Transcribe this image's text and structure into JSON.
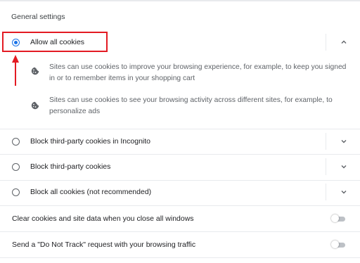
{
  "section": {
    "title": "General settings"
  },
  "options": [
    {
      "label": "Allow all cookies",
      "selected": true,
      "expanded": true,
      "icon": "chevron-up-icon"
    },
    {
      "label": "Block third-party cookies in Incognito",
      "selected": false,
      "expanded": false,
      "icon": "chevron-down-icon"
    },
    {
      "label": "Block third-party cookies",
      "selected": false,
      "expanded": false,
      "icon": "chevron-down-icon"
    },
    {
      "label": "Block all cookies (not recommended)",
      "selected": false,
      "expanded": false,
      "icon": "chevron-down-icon"
    }
  ],
  "allow_details": [
    {
      "icon": "cookie-icon",
      "text": "Sites can use cookies to improve your browsing experience, for example, to keep you signed in or to remember items in your shopping cart"
    },
    {
      "icon": "cookie-icon",
      "text": "Sites can use cookies to see your browsing activity across different sites, for example, to personalize ads"
    }
  ],
  "toggles": [
    {
      "label": "Clear cookies and site data when you close all windows",
      "on": false
    },
    {
      "label": "Send a \"Do Not Track\" request with your browsing traffic",
      "on": false
    }
  ],
  "annotation": {
    "box_color": "#e31b23",
    "arrow_color": "#e31b23"
  },
  "colors": {
    "accent": "#1a73e8",
    "divider": "#e8eaed",
    "secondary_text": "#5f6368"
  }
}
